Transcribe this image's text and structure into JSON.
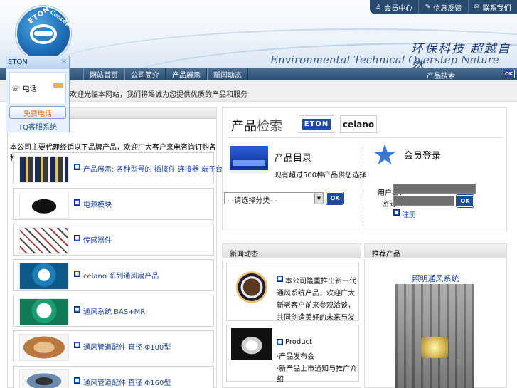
{
  "header": {
    "slogan_cn": "环保科技 超越自然",
    "slogan_en": "Environmental Technical Overstep Nature",
    "logo_text": "ETON",
    "logo_sub": "Concept",
    "top_links": [
      {
        "icon": "person-icon",
        "label": "会员中心"
      },
      {
        "icon": "info-icon",
        "label": "信息反馈"
      },
      {
        "icon": "mail-icon",
        "label": "联系我们"
      }
    ]
  },
  "nav": {
    "items": [
      "网站首页",
      "公司简介",
      "产品展示",
      "新闻动态"
    ],
    "search_label": "产品搜索",
    "ok_label": "OK"
  },
  "marquee": "欢迎光临本网站，我们将竭诚为您提供优质的产品和服务",
  "tq": {
    "title": "ETON",
    "close": "×",
    "phone_label": "电话",
    "free_call": "免费电话",
    "footer": "TQ客服系统"
  },
  "left": {
    "category_title": "本公司主要代理经销以下品牌产品，欢迎广大客户来电咨询订购各种产品。",
    "products": [
      {
        "label": "产品展示: 各种型号的 插接件 连接器 端子台 接线盒 系列产品"
      },
      {
        "label": "电源模块"
      },
      {
        "label": "传感器件"
      },
      {
        "label": "celano 系列通风扇产品"
      },
      {
        "label": "通风系统 BAS+MR"
      },
      {
        "label": "通风管道配件 直径 Φ100型"
      },
      {
        "label": "通风管道配件 直径 Φ160型"
      }
    ]
  },
  "search": {
    "title_a": "产品",
    "title_b": "检索",
    "brand_eton": "ETON",
    "brand_celano": "celano",
    "catalog_title": "产品目录",
    "catalog_sub": "现有超过500种产品供您选择",
    "select_value": "- -请选择分类- -",
    "ok": "OK",
    "login_title": "会员登录",
    "user_label": "用户名：",
    "pass_label": "密码：",
    "login_ok": "OK",
    "register": "注册"
  },
  "news": {
    "title": "新闻动态",
    "item1": "本公司隆重推出新一代通风系统产品，欢迎广大新老客户前来参观洽谈，共同创造美好的未来与发展。",
    "item2_title": "Product",
    "item2_l1": "·产品发布会",
    "item2_l2": "·新产品上市通知与推广介绍"
  },
  "promo": {
    "title": "推荐产品",
    "product_name": "照明通风系统"
  },
  "colors": {
    "nav_blue": "#294c72",
    "link_blue": "#1f46a0",
    "button_blue": "#1d4ca8"
  }
}
